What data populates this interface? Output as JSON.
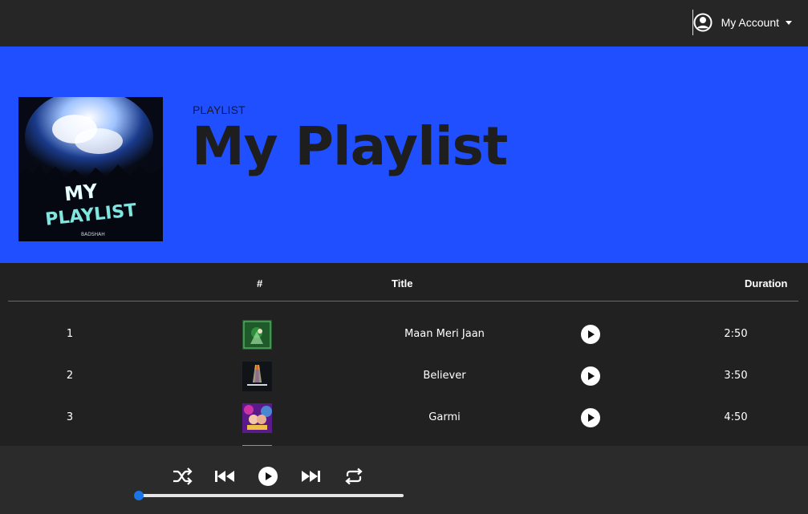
{
  "account": {
    "label": "My Account",
    "icon": "user-circle-icon"
  },
  "playlist": {
    "type_label": "PLAYLIST",
    "title": "My Playlist",
    "cover": {
      "line1": "MY",
      "line2": "PLAYLIST",
      "credit": "BADSHAH"
    }
  },
  "table": {
    "headers": {
      "number": "#",
      "title": "Title",
      "duration": "Duration"
    },
    "rows": [
      {
        "number": "1",
        "title": "Maan Meri Jaan",
        "duration": "2:50"
      },
      {
        "number": "2",
        "title": "Believer",
        "duration": "3:50"
      },
      {
        "number": "3",
        "title": "Garmi",
        "duration": "4:50"
      }
    ]
  },
  "player": {
    "progress": 0.0,
    "controls": [
      "shuffle-icon",
      "previous-icon",
      "play-icon",
      "next-icon",
      "repeat-icon"
    ]
  },
  "colors": {
    "hero_bg": "#1f4fff",
    "accent": "#1a73e8",
    "page_bg": "#212121",
    "bar_bg": "#262626"
  }
}
